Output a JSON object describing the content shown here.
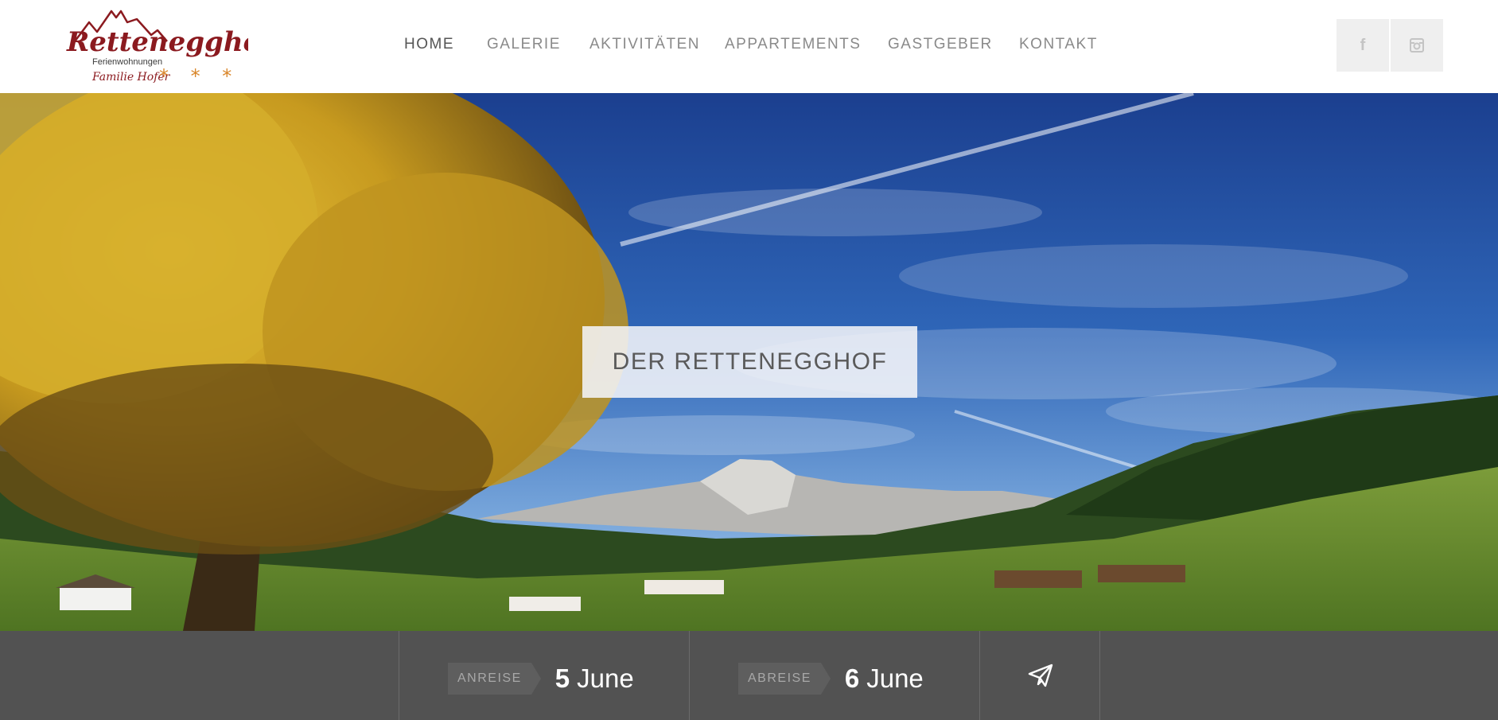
{
  "logo": {
    "name": "Rettenegghof",
    "subtitle": "Ferienwohnungen",
    "family": "Familie Hofer",
    "stars": "* * *"
  },
  "nav": {
    "items": [
      {
        "label": "HOME",
        "active": true
      },
      {
        "label": "GALERIE",
        "active": false
      },
      {
        "label": "AKTIVITÄTEN",
        "active": false
      },
      {
        "label": "APPARTEMENTS",
        "active": false
      },
      {
        "label": "GASTGEBER",
        "active": false
      },
      {
        "label": "KONTAKT",
        "active": false
      }
    ]
  },
  "social": {
    "facebook": "f",
    "instagram_icon": "instagram-icon"
  },
  "hero": {
    "title": "DER RETTENEGGHOF"
  },
  "booking": {
    "arrival_label": "ANREISE",
    "arrival_day": "5",
    "arrival_month": "June",
    "departure_label": "ABREISE",
    "departure_day": "6",
    "departure_month": "June",
    "send_icon": "paper-plane-icon"
  },
  "colors": {
    "brand": "#8b1a1f",
    "booking_bar": "#525252",
    "nav_text": "#8a8a8a"
  }
}
